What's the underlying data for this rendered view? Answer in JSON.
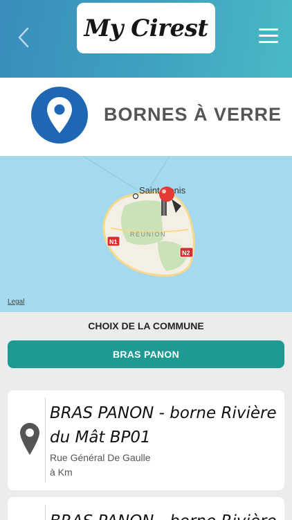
{
  "header": {
    "logo_text": "My Cirest",
    "back_icon": "chevron-left-icon",
    "menu_icon": "hamburger-menu-icon",
    "gradient": [
      "#3a8cbc",
      "#49b9c4"
    ]
  },
  "title_band": {
    "icon": "location-pin-icon",
    "icon_color": "#1f67b5",
    "title": "BORNES À VERRE"
  },
  "map": {
    "city_label": "Saint-Denis",
    "island_label": "REUNION",
    "road_labels": [
      "N1",
      "N2"
    ],
    "legal_label": "Legal",
    "marker_color": "#e53935"
  },
  "commune": {
    "label": "CHOIX DE LA COMMUNE",
    "selected": "BRAS PANON",
    "button_color": "#1e9a93"
  },
  "results": [
    {
      "title": "BRAS PANON - borne Rivière du Mât BP01",
      "address_line1": "Rue Général De Gaulle",
      "address_line2": "à Km",
      "icon": "map-pin-icon"
    },
    {
      "title": "BRAS PANON - borne Rivière",
      "icon": "map-pin-icon"
    }
  ]
}
